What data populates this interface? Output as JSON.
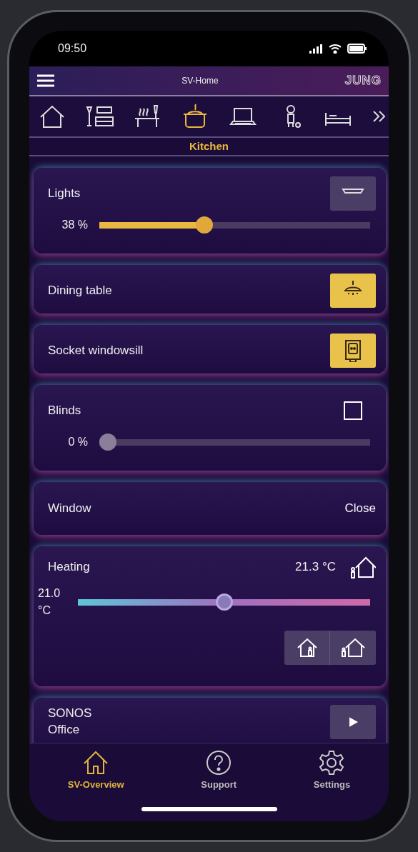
{
  "status_bar": {
    "time": "09:50"
  },
  "header": {
    "title": "SV-Home",
    "logo": "JUNG"
  },
  "rooms": [
    {
      "kind": "house",
      "selected": false
    },
    {
      "kind": "living",
      "selected": false
    },
    {
      "kind": "dining",
      "selected": false
    },
    {
      "kind": "kitchen",
      "selected": true
    },
    {
      "kind": "office",
      "selected": false
    },
    {
      "kind": "child",
      "selected": false
    },
    {
      "kind": "bedroom",
      "selected": false
    }
  ],
  "room_label": "Kitchen",
  "devices": [
    {
      "kind": "dimmer",
      "name": "Lights",
      "reading": "38 %",
      "level": 0.38,
      "on": false
    },
    {
      "kind": "switch",
      "name": "Dining table",
      "on": true
    },
    {
      "kind": "switch",
      "name": "Socket windowsill",
      "on": true
    },
    {
      "kind": "dimmer",
      "name": "Blinds",
      "reading": "0 %",
      "level": 0,
      "on": false
    },
    {
      "kind": "action",
      "name": "Window",
      "action": "Close"
    },
    {
      "kind": "heating",
      "name": "Heating",
      "current": "21.3 °C",
      "setpoint": "21.0 °C",
      "level": 0.5
    },
    {
      "kind": "media",
      "name": "SONOS",
      "room": "Office"
    }
  ],
  "nav": [
    {
      "label": "SV-Overview",
      "selected": true
    },
    {
      "label": "Support",
      "selected": false
    },
    {
      "label": "Settings",
      "selected": false
    }
  ]
}
